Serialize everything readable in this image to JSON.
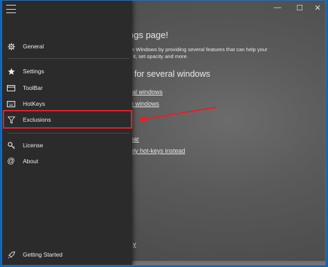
{
  "window": {
    "minimize_glyph": "—",
    "maximize_glyph": "☐",
    "close_glyph": "✕"
  },
  "background": {
    "heading": "ngs page!",
    "paragraph_line1": "on Windows by providing several features that can help your",
    "paragraph_line2": "g it, set opacity and more.",
    "section_heading": "for several windows",
    "link1": "ral windows",
    "link2": "n windows",
    "link3": "bar",
    "link4": "nly hot-keys instead",
    "link5": "y"
  },
  "nav": {
    "items": [
      {
        "label": "General",
        "icon": "gear-icon"
      },
      {
        "label": "Settings",
        "icon": "star-icon"
      },
      {
        "label": "ToolBar",
        "icon": "toolbar-icon"
      },
      {
        "label": "HotKeys",
        "icon": "keyboard-icon"
      },
      {
        "label": "Exclusions",
        "icon": "filter-icon"
      },
      {
        "label": "License",
        "icon": "key-icon"
      },
      {
        "label": "About",
        "icon": "at-icon"
      }
    ],
    "footer": {
      "label": "Getting Started",
      "icon": "rocket-icon"
    }
  },
  "annotation": {
    "highlight_color": "#e5202a"
  }
}
